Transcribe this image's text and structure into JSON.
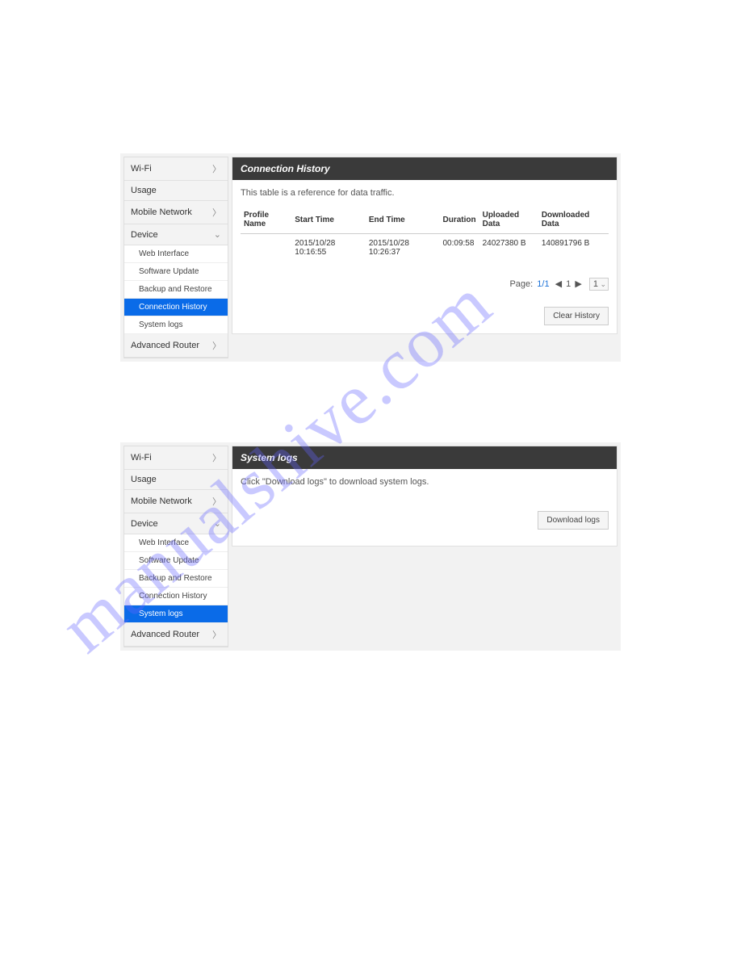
{
  "watermark": "manualshive.com",
  "sidebar1": {
    "wifi": "Wi-Fi",
    "usage": "Usage",
    "mobile": "Mobile Network",
    "device": "Device",
    "sub": {
      "web": "Web Interface",
      "soft": "Software Update",
      "backup": "Backup and Restore",
      "conn": "Connection History",
      "syslog": "System logs"
    },
    "adv": "Advanced Router"
  },
  "sidebar2": {
    "wifi": "Wi-Fi",
    "usage": "Usage",
    "mobile": "Mobile Network",
    "device": "Device",
    "sub": {
      "web": "Web Interface",
      "soft": "Software Update",
      "backup": "Backup and Restore",
      "conn": "Connection History",
      "syslog": "System logs"
    },
    "adv": "Advanced Router"
  },
  "section1": {
    "title": "Connection History",
    "desc": "This table is a reference for data traffic.",
    "headers": {
      "profile": "Profile Name",
      "start": "Start Time",
      "end": "End Time",
      "duration": "Duration",
      "uploaded": "Uploaded Data",
      "downloaded": "Downloaded Data"
    },
    "row": {
      "profile": "",
      "start": "2015/10/28 10:16:55",
      "end": "2015/10/28 10:26:37",
      "duration": "00:09:58",
      "uploaded": "24027380 B",
      "downloaded": "140891796 B"
    },
    "pager": {
      "label": "Page:",
      "current": "1/1",
      "mid": "1",
      "dropdown": "1"
    },
    "clear": "Clear History"
  },
  "section2": {
    "title": "System logs",
    "desc": "Click \"Download logs\" to download system logs.",
    "download": "Download logs"
  }
}
